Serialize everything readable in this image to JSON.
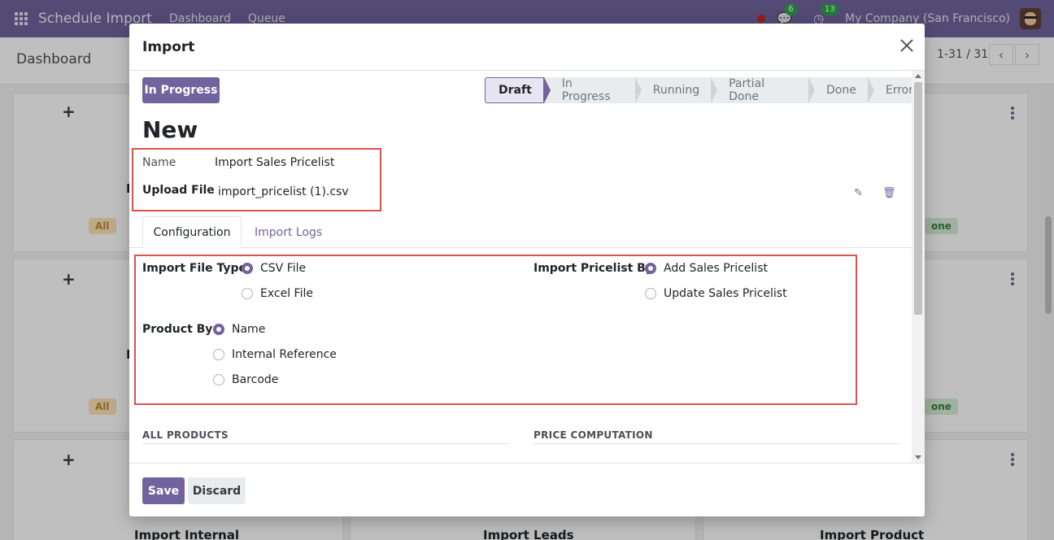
{
  "navbar": {
    "app_name": "Schedule Import",
    "menu": [
      "Dashboard",
      "Queue"
    ],
    "messages_count": "6",
    "activities_count": "13",
    "company": "My Company (San Francisco)"
  },
  "control_panel": {
    "title": "Dashboard",
    "pager": "1-31 / 31"
  },
  "background": {
    "cards": [
      {
        "tag_all": "All",
        "tag_done": "one",
        "initial": "I"
      },
      {
        "tag_all": "All",
        "tag_done": "one",
        "initial": "I"
      }
    ],
    "bottom_titles": [
      "Import Internal",
      "Import Leads",
      "Import Product"
    ]
  },
  "modal": {
    "title": "Import",
    "status_button": "In Progress",
    "stages": [
      "Draft",
      "In Progress",
      "Running",
      "Partial Done",
      "Done",
      "Error"
    ],
    "active_stage": "Draft",
    "record_title": "New",
    "name_label": "Name",
    "name_value": "Import Sales Pricelist",
    "upload_label": "Upload File",
    "upload_value": "import_pricelist (1).csv",
    "tabs": [
      "Configuration",
      "Import Logs"
    ],
    "import_file_type": {
      "label": "Import File Type",
      "options": [
        "CSV File",
        "Excel File"
      ],
      "selected": "CSV File"
    },
    "import_pricelist_by": {
      "label": "Import Pricelist By",
      "options": [
        "Add Sales Pricelist",
        "Update Sales Pricelist"
      ],
      "selected": "Add Sales Pricelist"
    },
    "product_by": {
      "label": "Product By",
      "options": [
        "Name",
        "Internal Reference",
        "Barcode"
      ],
      "selected": "Name"
    },
    "section_left": "ALL PRODUCTS",
    "section_right": "PRICE COMPUTATION",
    "save_label": "Save",
    "discard_label": "Discard"
  },
  "colors": {
    "brand": "#71639e",
    "highlight_box": "#d9534f"
  }
}
